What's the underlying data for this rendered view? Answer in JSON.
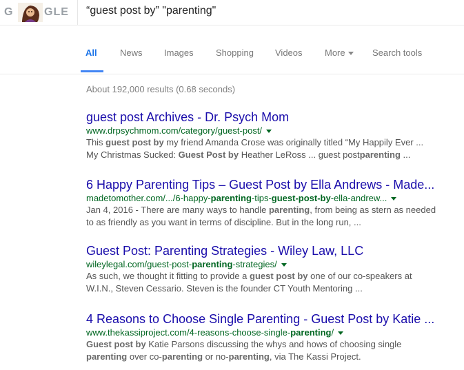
{
  "logo": {
    "text_left": "G",
    "text_right": "GLE"
  },
  "search": {
    "query": "“guest post by” \"parenting\""
  },
  "tabs": [
    {
      "label": "All",
      "active": true
    },
    {
      "label": "News"
    },
    {
      "label": "Images"
    },
    {
      "label": "Shopping"
    },
    {
      "label": "Videos"
    },
    {
      "label": "More"
    },
    {
      "label": "Search tools"
    }
  ],
  "stats": "About 192,000 results (0.68 seconds)",
  "results": [
    {
      "title": "guest post Archives - Dr. Psych Mom",
      "url": "www.drpsychmom.com/category/guest-post/",
      "snippet": [
        [
          "This ",
          "guest post by",
          " my friend Amanda Crose was originally titled “My Happily Ever ..."
        ],
        [
          "My Christmas Sucked: ",
          "Guest Post by",
          " Heather LeRoss ... guest post",
          "parenting",
          " ..."
        ]
      ]
    },
    {
      "title": "6 Happy Parenting Tips – Guest Post by Ella Andrews - Made...",
      "url_parts": [
        "madetomother.com/.../6-happy-",
        "parenting",
        "-tips-",
        "guest-post-by",
        "-ella-andrew..."
      ],
      "snippet": [
        [
          "Jan 4, 2016 - There are many ways to handle ",
          "parenting",
          ", from being as stern as needed"
        ],
        [
          "to as friendly as you want in terms of discipline. But in the long run, ..."
        ]
      ]
    },
    {
      "title": "Guest Post: Parenting Strategies - Wiley Law, LLC",
      "url_parts": [
        "wileylegal.com/guest-post-",
        "parenting",
        "-strategies/"
      ],
      "snippet": [
        [
          "As such, we thought it fitting to provide a ",
          "guest post by",
          " one of our co-speakers at"
        ],
        [
          "W.I.N., Steven Cessario. Steven is the founder CT Youth Mentoring ..."
        ]
      ]
    },
    {
      "title": "4 Reasons to Choose Single Parenting - Guest Post by Katie ...",
      "url_parts": [
        "www.thekassiproject.com/4-reasons-choose-single-",
        "parenting",
        "/"
      ],
      "snippet": [
        [
          "Guest post by",
          " Katie Parsons discussing the whys and hows of choosing single"
        ],
        [
          "parenting",
          " over co-",
          "parenting",
          " or no-",
          "parenting",
          ", via The Kassi Project."
        ]
      ]
    }
  ]
}
